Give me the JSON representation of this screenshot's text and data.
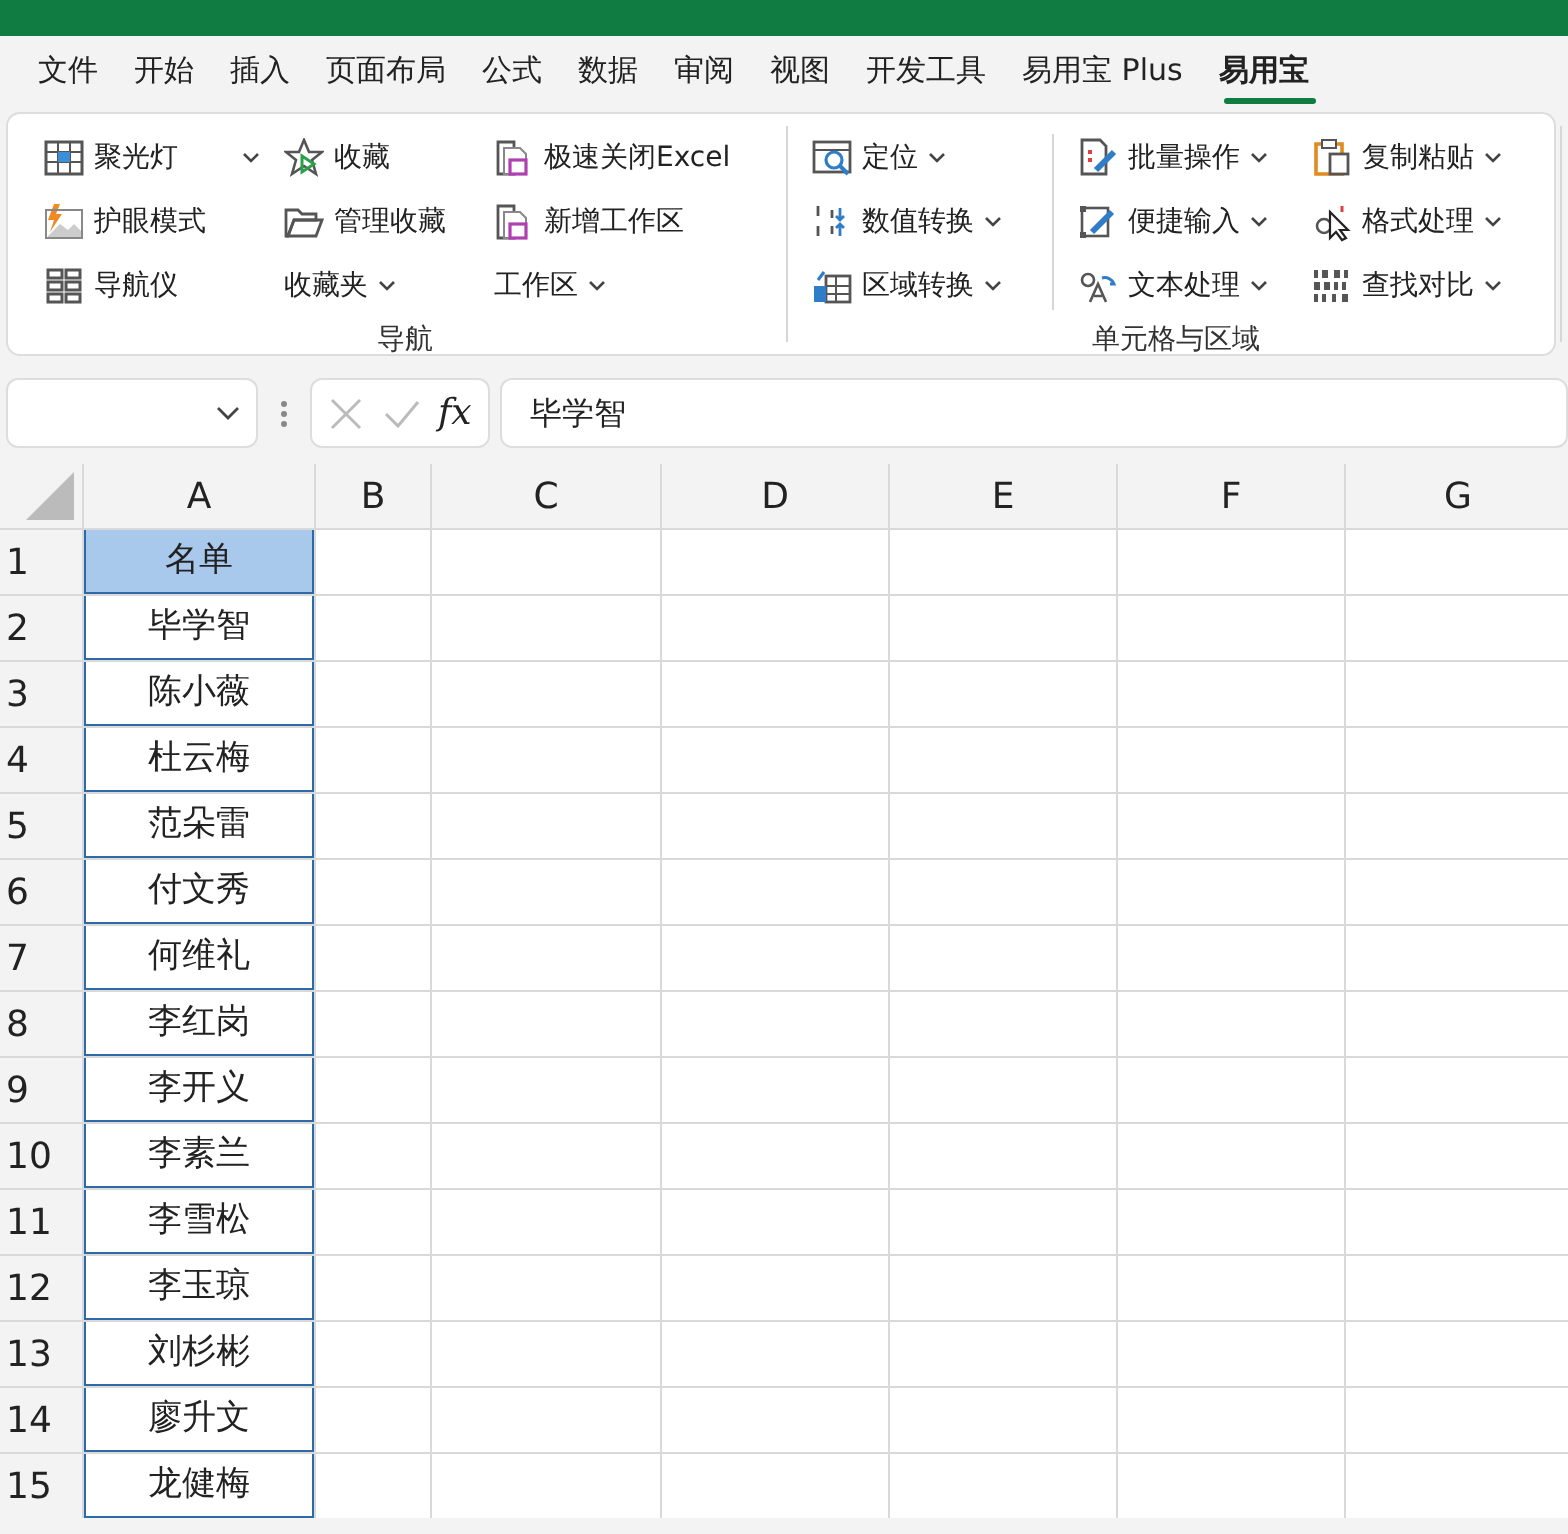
{
  "tabs": [
    {
      "label": "文件",
      "selected": false
    },
    {
      "label": "开始",
      "selected": false
    },
    {
      "label": "插入",
      "selected": false
    },
    {
      "label": "页面布局",
      "selected": false
    },
    {
      "label": "公式",
      "selected": false
    },
    {
      "label": "数据",
      "selected": false
    },
    {
      "label": "审阅",
      "selected": false
    },
    {
      "label": "视图",
      "selected": false
    },
    {
      "label": "开发工具",
      "selected": false
    },
    {
      "label": "易用宝 Plus",
      "selected": false
    },
    {
      "label": "易用宝",
      "selected": true
    }
  ],
  "ribbon_groups": [
    {
      "label": "导航",
      "columns": [
        [
          {
            "label": "聚光灯",
            "dropdown": true
          },
          {
            "label": "护眼模式",
            "dropdown": false
          },
          {
            "label": "导航仪",
            "dropdown": false
          }
        ],
        [
          {
            "label": "收藏",
            "dropdown": false
          },
          {
            "label": "管理收藏",
            "dropdown": false
          },
          {
            "label": "收藏夹",
            "dropdown": true
          }
        ],
        [
          {
            "label": "极速关闭Excel",
            "dropdown": false
          },
          {
            "label": "新增工作区",
            "dropdown": false
          },
          {
            "label": "工作区",
            "dropdown": true
          }
        ]
      ]
    },
    {
      "label": "单元格与区域",
      "columns": [
        [
          {
            "label": "定位",
            "dropdown": true
          },
          {
            "label": "数值转换",
            "dropdown": true
          },
          {
            "label": "区域转换",
            "dropdown": true
          }
        ],
        [
          {
            "label": "批量操作",
            "dropdown": true
          },
          {
            "label": "便捷输入",
            "dropdown": true
          },
          {
            "label": "文本处理",
            "dropdown": true
          }
        ],
        [
          {
            "label": "复制粘贴",
            "dropdown": true
          },
          {
            "label": "格式处理",
            "dropdown": true
          },
          {
            "label": "查找对比",
            "dropdown": true
          }
        ]
      ]
    }
  ],
  "formula_bar": {
    "fx": "fx",
    "value": "毕学智"
  },
  "sheet": {
    "columns": [
      "A",
      "B",
      "C",
      "D",
      "E",
      "F",
      "G"
    ],
    "rows": [
      {
        "number": "1",
        "a": "名单",
        "kind": "header"
      },
      {
        "number": "2",
        "a": "毕学智",
        "kind": "data"
      },
      {
        "number": "3",
        "a": "陈小薇",
        "kind": "data"
      },
      {
        "number": "4",
        "a": "杜云梅",
        "kind": "data"
      },
      {
        "number": "5",
        "a": "范朵雷",
        "kind": "data"
      },
      {
        "number": "6",
        "a": "付文秀",
        "kind": "data"
      },
      {
        "number": "7",
        "a": "何维礼",
        "kind": "data"
      },
      {
        "number": "8",
        "a": "李红岗",
        "kind": "data"
      },
      {
        "number": "9",
        "a": "李开义",
        "kind": "data"
      },
      {
        "number": "10",
        "a": "李素兰",
        "kind": "data"
      },
      {
        "number": "11",
        "a": "李雪松",
        "kind": "data"
      },
      {
        "number": "12",
        "a": "李玉琼",
        "kind": "data"
      },
      {
        "number": "13",
        "a": "刘杉彬",
        "kind": "data"
      },
      {
        "number": "14",
        "a": "廖升文",
        "kind": "data"
      },
      {
        "number": "15",
        "a": "龙健梅",
        "kind": "data"
      }
    ]
  }
}
